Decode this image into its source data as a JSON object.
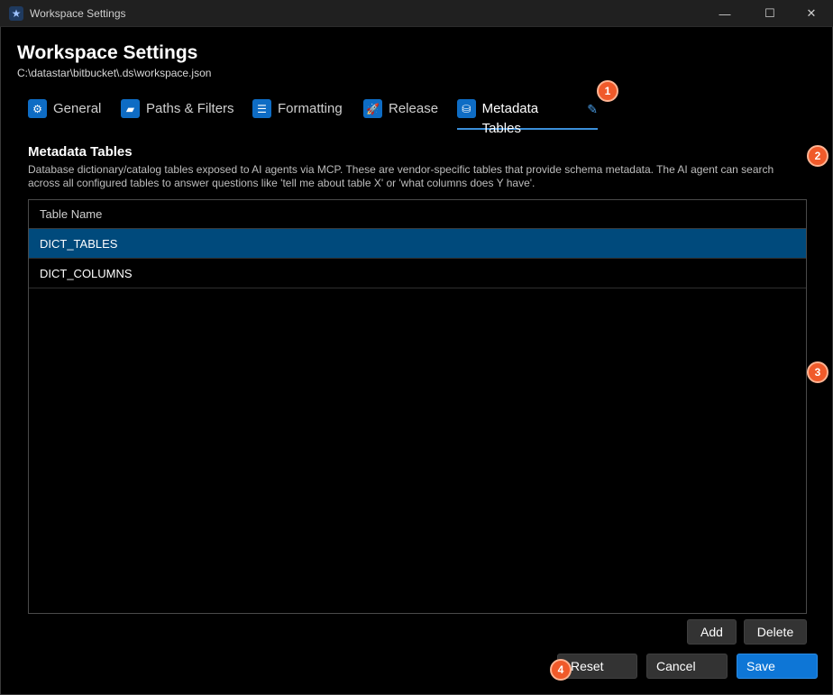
{
  "window": {
    "title": "Workspace Settings",
    "app_icon": "star-icon",
    "controls": {
      "minimize": "—",
      "maximize": "☐",
      "close": "✕"
    }
  },
  "header": {
    "title": "Workspace Settings",
    "path": "C:\\datastar\\bitbucket\\.ds\\workspace.json"
  },
  "tabs": [
    {
      "label": "General",
      "icon": "gear-icon",
      "glyph": "⚙"
    },
    {
      "label": "Paths & Filters",
      "icon": "folder-icon",
      "glyph": "▰"
    },
    {
      "label": "Formatting",
      "icon": "list-icon",
      "glyph": "☰"
    },
    {
      "label": "Release",
      "icon": "rocket-icon",
      "glyph": "🚀"
    },
    {
      "label": "Metadata Tables",
      "icon": "database-refresh-icon",
      "glyph": "⛁",
      "active": true,
      "edit_glyph": "✎"
    }
  ],
  "badges": [
    "1",
    "2",
    "3",
    "4"
  ],
  "section": {
    "title": "Metadata Tables",
    "description": "Database dictionary/catalog tables exposed to AI agents via MCP. These are vendor-specific tables that provide schema metadata. The AI agent can search across all configured tables to answer questions like 'tell me about table X' or 'what columns does Y have'."
  },
  "grid": {
    "header": "Table Name",
    "rows": [
      "DICT_TABLES",
      "DICT_COLUMNS"
    ],
    "selected_index": 0
  },
  "buttons": {
    "add": "Add",
    "delete": "Delete",
    "reset": "Reset",
    "cancel": "Cancel",
    "save": "Save"
  },
  "colors": {
    "accent": "#0e76d6",
    "selected_row": "#004a7c",
    "badge": "#f05a2a"
  }
}
